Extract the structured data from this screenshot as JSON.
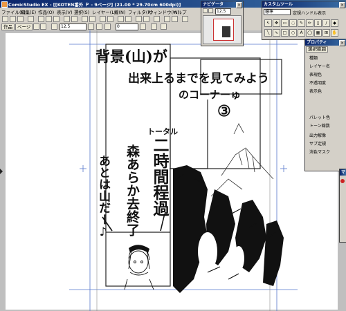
{
  "window": {
    "title": "ComicStudio EX - [[KOTEN番外 Ｐ - 9ページ] (21.00 * 29.70cm 600dpi)]"
  },
  "menu": [
    "ファイル(F)",
    "編集(E)",
    "作品(O)",
    "表示(V)",
    "選択(S)",
    "レイヤー(L)",
    "線(N)",
    "フィルタ(R)",
    "ウィンドウ(W)",
    "ヘルプ"
  ],
  "bar2": {
    "tabs": [
      "作品",
      "ページ"
    ],
    "zoom_value": "12.5",
    "angle_value": "0"
  },
  "navigator": {
    "title": "ナビゲータ",
    "zoom_value": "12.5"
  },
  "custom_tool": {
    "title": "カスタムツール",
    "select_value": "標準",
    "button_label": "定規ハンドル表示"
  },
  "property": {
    "title": "プロパティ",
    "tab": "選択範囲",
    "rows": [
      "種類",
      "レイヤー名",
      "表現色",
      "不透明度",
      "表示色",
      "パレット色",
      "トーン線数",
      "出力解像",
      "サブ定規",
      "消色マスク"
    ]
  },
  "small_panel": {
    "title": "マ"
  },
  "manga": {
    "heading_line1": "背景(山)が",
    "heading_line2": "出来上るまでを見てみよう",
    "heading_line3": "のコーナーゅ",
    "circled_number": "③",
    "total_label": "トータル",
    "time_text": "二時間程過",
    "mori_text": "森あらか去終了",
    "rest_text": "あとは山だー♪"
  },
  "colors": {
    "titlebar": "#0a246a",
    "panel_bg": "#d4d0c8",
    "canvas_bg": "#bfbfbf",
    "guide_blue": "#5577cc"
  }
}
